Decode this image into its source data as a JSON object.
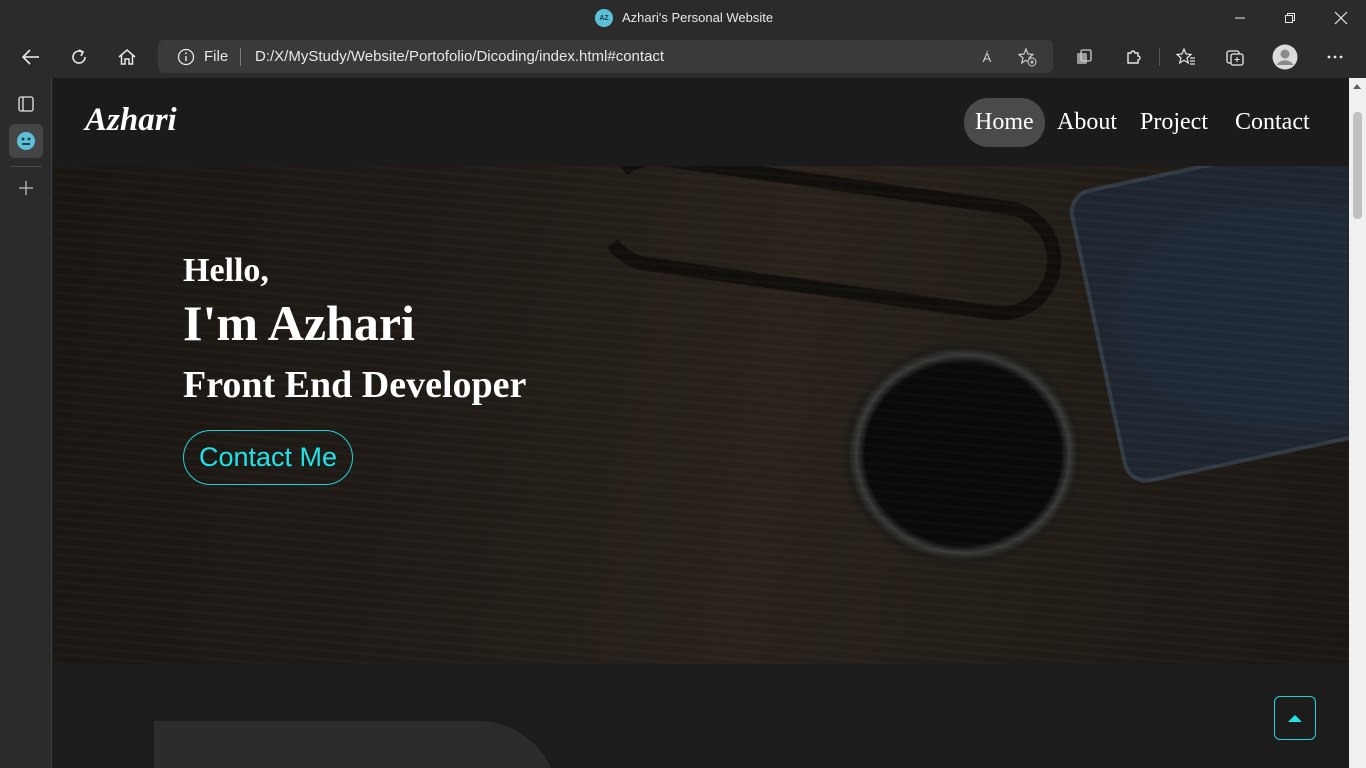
{
  "browser": {
    "window_title": "Azhari's Personal Website",
    "tab_favicon_text": "AZ",
    "address": {
      "scheme_label": "File",
      "url": "D:/X/MyStudy/Website/Portofolio/Dicoding/index.html#contact"
    },
    "icons": {
      "back": "back-arrow-icon",
      "refresh": "refresh-icon",
      "home": "home-icon",
      "info": "info-icon",
      "read_aloud": "read-aloud-icon",
      "add_favorite": "add-favorite-icon",
      "collections": "collections-icon",
      "extensions": "extensions-icon",
      "favorites": "favorites-icon",
      "tab_actions": "tab-actions-icon",
      "profile": "profile-icon",
      "more": "more-icon"
    },
    "read_aloud_glyph": "Á"
  },
  "site": {
    "logo": "Azhari",
    "nav": [
      {
        "label": "Home",
        "active": true
      },
      {
        "label": "About",
        "active": false
      },
      {
        "label": "Project",
        "active": false
      },
      {
        "label": "Contact",
        "active": false
      }
    ],
    "hero": {
      "greeting": "Hello,",
      "name": "I'm Azhari",
      "role": "Front End Developer",
      "cta": "Contact Me"
    }
  },
  "colors": {
    "accent": "#1fe3e8",
    "nav_active_bg": "#4a4a4a",
    "page_bg": "#1c1c1c"
  }
}
